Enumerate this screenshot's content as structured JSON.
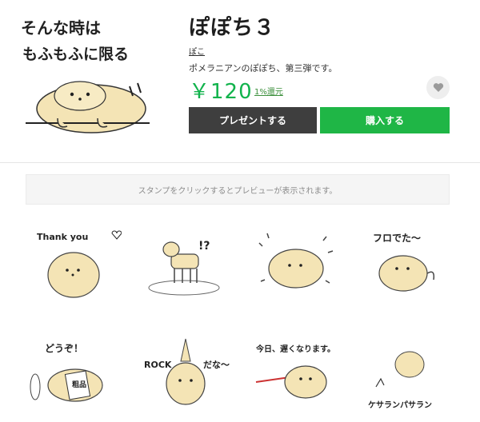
{
  "product": {
    "title": "ぽぽち３",
    "author": "ぽこ",
    "description": "ポメラニアンのぽぽち、第三弾です。",
    "price": "￥120",
    "reward": "1%還元",
    "main_sticker_text_line1": "そんな時は",
    "main_sticker_text_line2": "もふもふに限る"
  },
  "buttons": {
    "gift": "プレゼントする",
    "buy": "購入する"
  },
  "preview_hint": "スタンプをクリックするとプレビューが表示されます。",
  "stickers": [
    {
      "text": "Thank you"
    },
    {
      "text": "!?"
    },
    {
      "text": ""
    },
    {
      "text": "フロでた～"
    },
    {
      "text": "どうぞ！"
    },
    {
      "text": "ROCK"
    },
    {
      "text": "今日、遅くなります。"
    },
    {
      "text": "ケサランパサラン"
    }
  ],
  "sticker_extra": {
    "rock_suffix": "だな～",
    "paper_text": "粗品"
  },
  "colors": {
    "accent_green": "#1fb646",
    "gift_dark": "#3e3e3e",
    "price_green": "#11b34c",
    "fur": "#f4e4b5"
  },
  "icons": {
    "favorite": "heart-icon"
  }
}
